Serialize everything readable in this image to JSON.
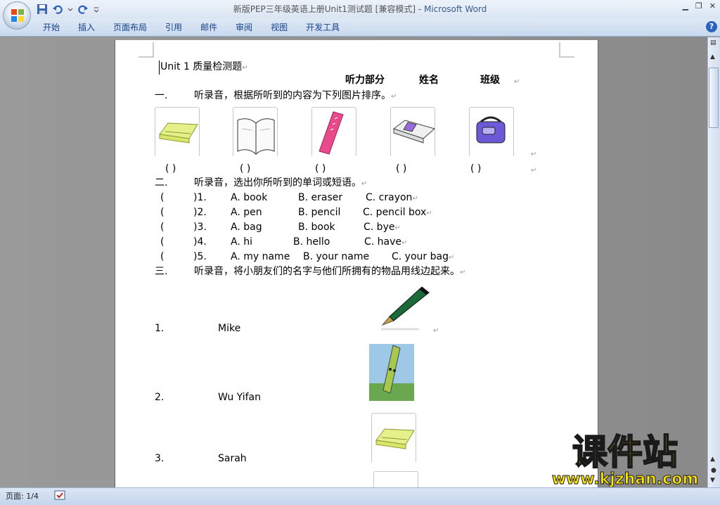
{
  "window": {
    "title_doc": "新版PEP三年级英语上册Unit1测试题 [兼容模式] - ",
    "title_app": "Microsoft Word"
  },
  "ribbon": {
    "tabs": [
      "开始",
      "插入",
      "页面布局",
      "引用",
      "邮件",
      "审阅",
      "视图",
      "开发工具"
    ]
  },
  "document": {
    "heading": "Unit 1 质量检测题",
    "header_fields": [
      "听力部分",
      "姓名",
      "班级"
    ],
    "section1": {
      "number": "一.",
      "instruction": "听录音，根据所听到的内容为下列图片排序。",
      "blank": "(      )"
    },
    "section2": {
      "number": "二.",
      "instruction": "听录音，选出你所听到的单词或短语。",
      "items": [
        {
          "num": ")1.",
          "a": "A. book",
          "b": "B. eraser",
          "c": "C. crayon"
        },
        {
          "num": ")2.",
          "a": "A. pen",
          "b": "B. pencil",
          "c": "C. pencil box"
        },
        {
          "num": ")3.",
          "a": "A. bag",
          "b": "B. book",
          "c": "C. bye"
        },
        {
          "num": ")4.",
          "a": "A. hi",
          "b": "B. hello",
          "c": "C. have"
        },
        {
          "num": ")5.",
          "a": "A. my name",
          "b": "B. your name",
          "c": "C. your bag"
        }
      ],
      "open_paren": "("
    },
    "section3": {
      "number": "三.",
      "instruction": "听录音，将小朋友们的名字与他们所拥有的物品用线边起来。",
      "rows": [
        {
          "num": "1.",
          "name": "Mike"
        },
        {
          "num": "2.",
          "name": "Wu Yifan"
        },
        {
          "num": "3.",
          "name": "Sarah"
        }
      ]
    },
    "paragraph_mark": "↵"
  },
  "status": {
    "page": "页面: 1/4"
  },
  "watermark": {
    "line1": "课件站",
    "line2": "www.kjzhan.com"
  },
  "colors": {
    "accent": "#15428b",
    "watermark_yellow": "#ffe600"
  }
}
